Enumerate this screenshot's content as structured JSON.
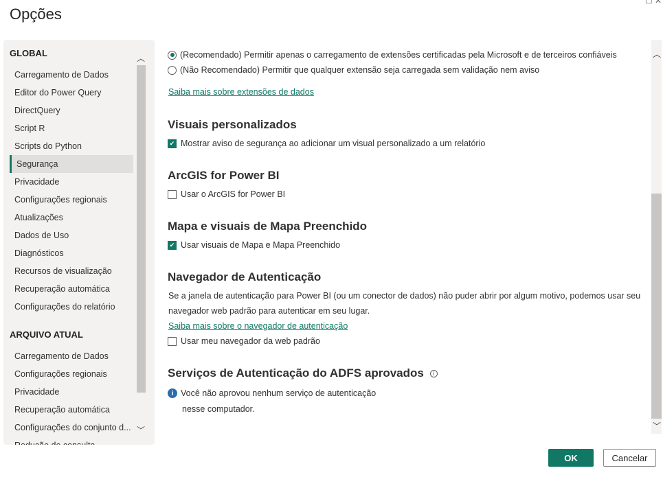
{
  "title": "Opções",
  "sidebar": {
    "global_header": "GLOBAL",
    "global_items": [
      "Carregamento de Dados",
      "Editor do Power Query",
      "DirectQuery",
      "Script R",
      "Scripts do Python",
      "Segurança",
      "Privacidade",
      "Configurações regionais",
      "Atualizações",
      "Dados de Uso",
      "Diagnósticos",
      "Recursos de visualização",
      "Recuperação automática",
      "Configurações do relatório"
    ],
    "selected": "Segurança",
    "file_header": "ARQUIVO ATUAL",
    "file_items": [
      "Carregamento de Dados",
      "Configurações regionais",
      "Privacidade",
      "Recuperação automática",
      "Configurações do conjunto d...",
      "Redução de consulta"
    ]
  },
  "main": {
    "ext_radio_recommended": "(Recomendado) Permitir apenas o carregamento de extensões certificadas pela Microsoft e de terceiros confiáveis",
    "ext_radio_not_recommended": "(Não Recomendado) Permitir que qualquer extensão seja carregada sem validação nem aviso",
    "ext_link": "Saiba mais sobre extensões de dados",
    "visuals_heading": "Visuais personalizados",
    "visuals_checkbox": "Mostrar aviso de segurança ao adicionar um visual personalizado a um relatório",
    "arcgis_heading": "ArcGIS for Power BI",
    "arcgis_checkbox": "Usar o ArcGIS for Power BI",
    "map_heading": "Mapa e visuais de Mapa Preenchido",
    "map_checkbox": "Usar visuais de Mapa e Mapa Preenchido",
    "auth_heading": "Navegador de Autenticação",
    "auth_desc_1": "Se a janela de autenticação para Power BI (ou um conector de dados) não puder abrir por algum motivo, podemos usar seu",
    "auth_desc_2": "navegador web padrão para autenticar em seu lugar.",
    "auth_link": "Saiba mais sobre o navegador de autenticação",
    "auth_checkbox": "Usar meu navegador da web padrão",
    "adfs_heading": "Serviços de Autenticação do ADFS aprovados",
    "adfs_info_1": "Você não aprovou nenhum serviço de autenticação",
    "adfs_info_2": "nesse computador."
  },
  "states": {
    "visuals": true,
    "arcgis": false,
    "map": true,
    "auth_browser": false,
    "ext_choice": "recommended"
  },
  "buttons": {
    "ok": "OK",
    "cancel": "Cancelar"
  },
  "colors": {
    "accent": "#117865"
  }
}
